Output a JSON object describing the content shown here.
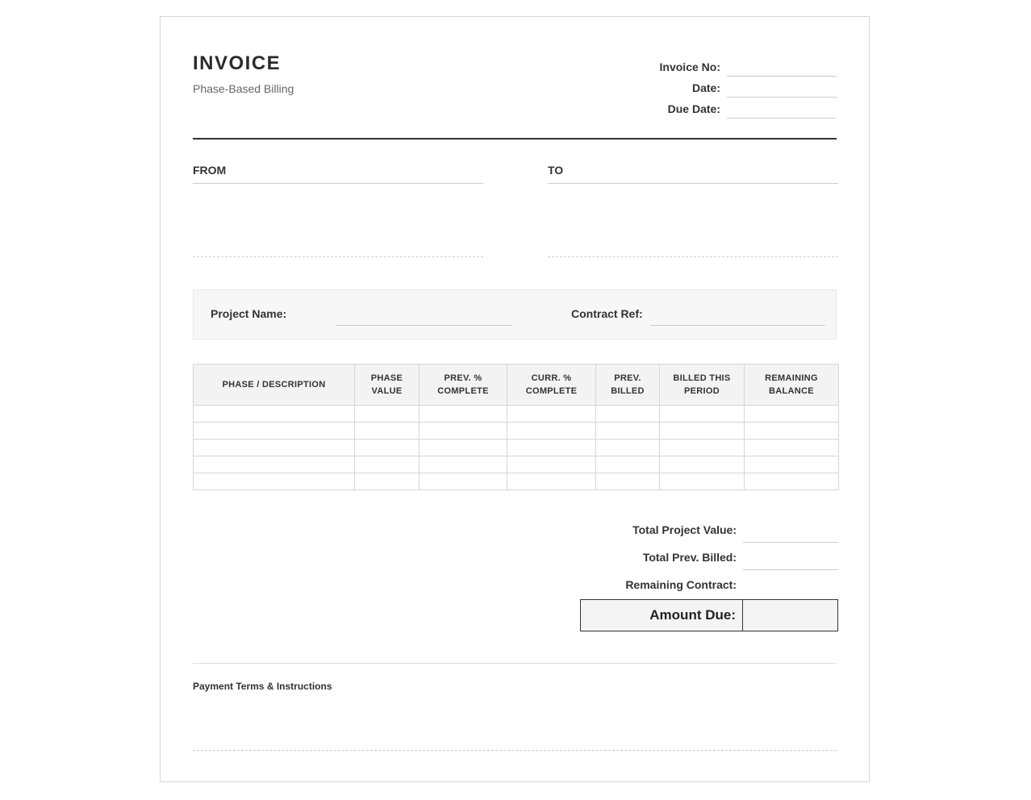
{
  "header": {
    "title": "INVOICE",
    "subtitle": "Phase-Based Billing"
  },
  "meta": {
    "invoice_no_label": "Invoice No:",
    "date_label": "Date:",
    "due_date_label": "Due Date:"
  },
  "parties": {
    "from_label": "FROM",
    "to_label": "TO"
  },
  "project": {
    "name_label": "Project Name:",
    "contract_label": "Contract Ref:"
  },
  "table": {
    "columns": [
      "Phase / Description",
      "Phase Value",
      "Prev. % Complete",
      "Curr. % Complete",
      "Prev. Billed",
      "Billed This Period",
      "Remaining Balance"
    ]
  },
  "totals": {
    "total_project_value_label": "Total Project Value:",
    "total_prev_billed_label": "Total Prev. Billed:",
    "remaining_contract_label": "Remaining Contract:",
    "amount_due_label": "Amount Due:"
  },
  "terms": {
    "title": "Payment Terms & Instructions"
  }
}
